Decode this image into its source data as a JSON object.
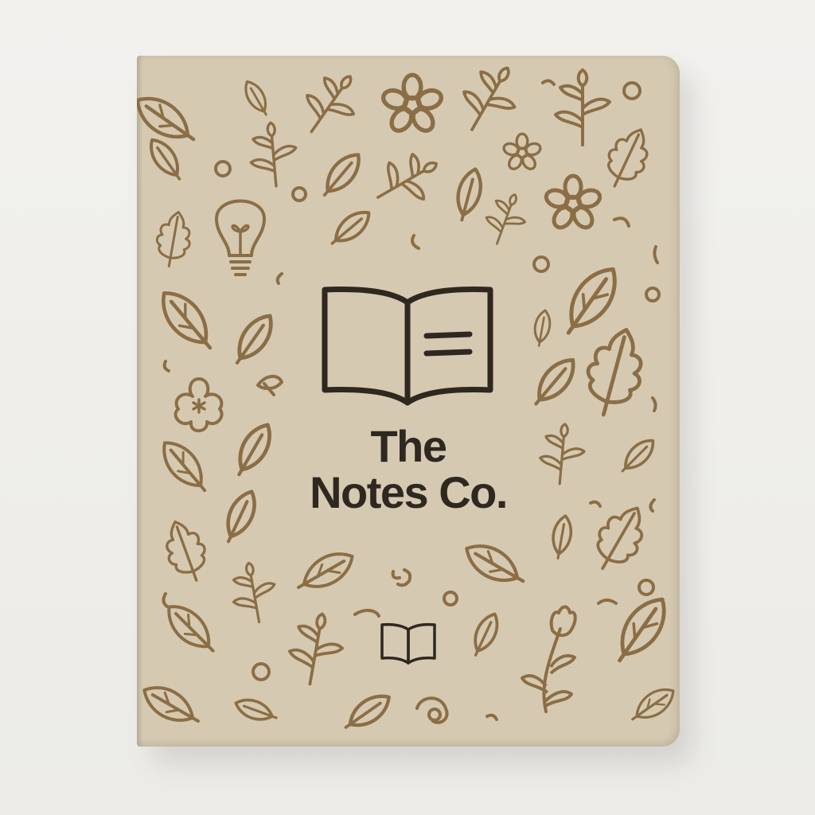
{
  "brand": {
    "line1": "The",
    "line2": "Notes Co."
  },
  "colors": {
    "background": "#efedea",
    "cover": "#d6c9b1",
    "doodle": "#8b6e45",
    "ink": "#2e2821"
  },
  "icons": [
    "open-book-icon",
    "light-bulb-icon",
    "leaf-icon",
    "flower-icon",
    "sprig-icon",
    "oak-leaf-icon",
    "tulip-icon",
    "small-book-icon"
  ]
}
